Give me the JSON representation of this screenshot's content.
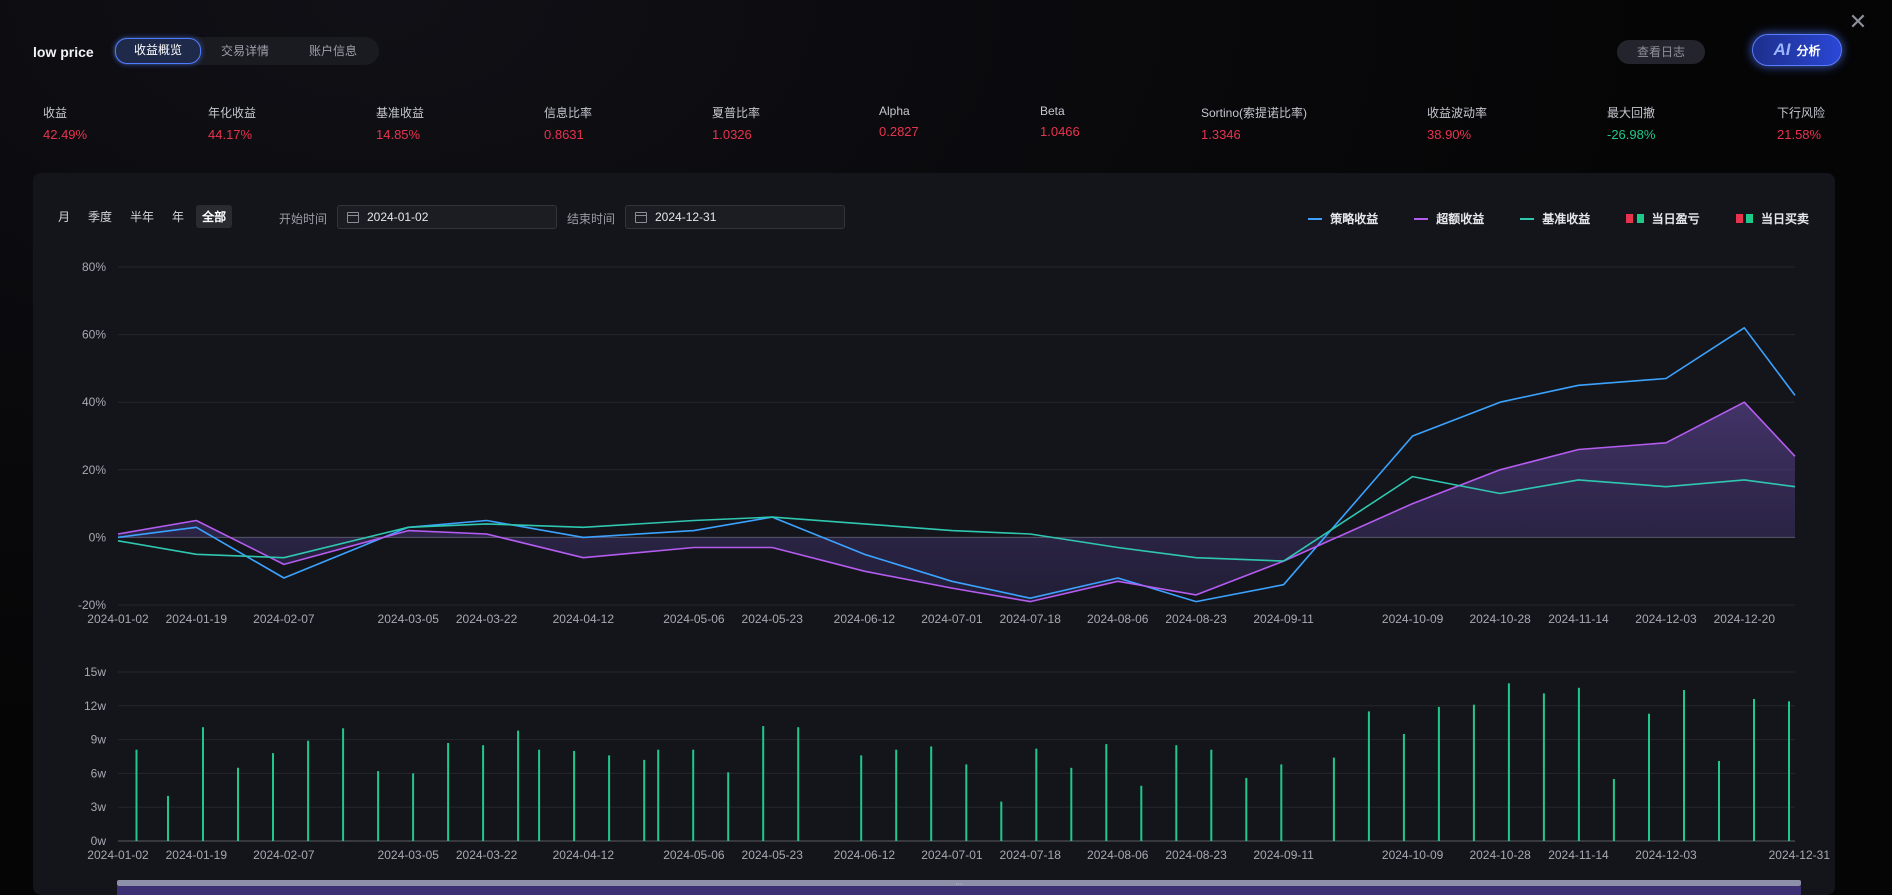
{
  "strategy_name": "low price",
  "tabs": [
    {
      "label": "收益概览",
      "active": true
    },
    {
      "label": "交易详情",
      "active": false
    },
    {
      "label": "账户信息",
      "active": false
    }
  ],
  "log_button": "查看日志",
  "ai_button": {
    "mark": "AI",
    "label": "分析"
  },
  "metrics": [
    {
      "label": "收益",
      "value": "42.49%",
      "tone": "red"
    },
    {
      "label": "年化收益",
      "value": "44.17%",
      "tone": "red"
    },
    {
      "label": "基准收益",
      "value": "14.85%",
      "tone": "red"
    },
    {
      "label": "信息比率",
      "value": "0.8631",
      "tone": "red"
    },
    {
      "label": "夏普比率",
      "value": "1.0326",
      "tone": "red"
    },
    {
      "label": "Alpha",
      "value": "0.2827",
      "tone": "red"
    },
    {
      "label": "Beta",
      "value": "1.0466",
      "tone": "red"
    },
    {
      "label": "Sortino(索提诺比率)",
      "value": "1.3346",
      "tone": "red"
    },
    {
      "label": "收益波动率",
      "value": "38.90%",
      "tone": "red"
    },
    {
      "label": "最大回撤",
      "value": "-26.98%",
      "tone": "green"
    },
    {
      "label": "下行风险",
      "value": "21.58%",
      "tone": "red"
    }
  ],
  "periods": [
    {
      "label": "月",
      "active": false
    },
    {
      "label": "季度",
      "active": false
    },
    {
      "label": "半年",
      "active": false
    },
    {
      "label": "年",
      "active": false
    },
    {
      "label": "全部",
      "active": true
    }
  ],
  "start_label": "开始时间",
  "start_date": "2024-01-02",
  "end_label": "结束时间",
  "end_date": "2024-12-31",
  "legend": [
    {
      "label": "策略收益",
      "kind": "line",
      "colors": [
        "#3ba3ff"
      ]
    },
    {
      "label": "超额收益",
      "kind": "line",
      "colors": [
        "#b45cf0"
      ]
    },
    {
      "label": "基准收益",
      "kind": "line",
      "colors": [
        "#2fc7b0"
      ]
    },
    {
      "label": "当日盈亏",
      "kind": "squares",
      "colors": [
        "#e8334f",
        "#1fc98a"
      ]
    },
    {
      "label": "当日买卖",
      "kind": "squares",
      "colors": [
        "#e8334f",
        "#1fc98a"
      ]
    }
  ],
  "colors": {
    "strategy": "#3ba3ff",
    "excess": "#b45cf0",
    "benchmark": "#2fc7b0",
    "up": "#e8334f",
    "down": "#1fc98a"
  },
  "chart_data": [
    {
      "type": "line",
      "title": "",
      "x_ticks": [
        "2024-01-02",
        "2024-01-19",
        "2024-02-07",
        "2024-03-05",
        "2024-03-22",
        "2024-04-12",
        "2024-05-06",
        "2024-05-23",
        "2024-06-12",
        "2024-07-01",
        "2024-07-18",
        "2024-08-06",
        "2024-08-23",
        "2024-09-11",
        "2024-10-09",
        "2024-10-28",
        "2024-11-14",
        "2024-12-03",
        "2024-12-20"
      ],
      "y_ticks": [
        "80%",
        "60%",
        "40%",
        "20%",
        "0%",
        "-20%"
      ],
      "ylim": [
        -20,
        80
      ],
      "grid": true,
      "series": [
        {
          "name": "策略收益",
          "color": "#3ba3ff",
          "x": [
            "2024-01-02",
            "2024-01-19",
            "2024-02-07",
            "2024-03-05",
            "2024-03-22",
            "2024-04-12",
            "2024-05-06",
            "2024-05-23",
            "2024-06-12",
            "2024-07-01",
            "2024-07-18",
            "2024-08-06",
            "2024-08-23",
            "2024-09-11",
            "2024-10-09",
            "2024-10-28",
            "2024-11-14",
            "2024-12-03",
            "2024-12-20",
            "2024-12-31"
          ],
          "values": [
            0,
            3,
            -12,
            3,
            5,
            0,
            2,
            6,
            -5,
            -13,
            -18,
            -12,
            -19,
            -14,
            30,
            40,
            45,
            47,
            62,
            42
          ]
        },
        {
          "name": "超额收益",
          "color": "#b45cf0",
          "x": [
            "2024-01-02",
            "2024-01-19",
            "2024-02-07",
            "2024-03-05",
            "2024-03-22",
            "2024-04-12",
            "2024-05-06",
            "2024-05-23",
            "2024-06-12",
            "2024-07-01",
            "2024-07-18",
            "2024-08-06",
            "2024-08-23",
            "2024-09-11",
            "2024-10-09",
            "2024-10-28",
            "2024-11-14",
            "2024-12-03",
            "2024-12-20",
            "2024-12-31"
          ],
          "values": [
            1,
            5,
            -8,
            2,
            1,
            -6,
            -3,
            -3,
            -10,
            -15,
            -19,
            -13,
            -17,
            -7,
            10,
            20,
            26,
            28,
            40,
            24
          ]
        },
        {
          "name": "基准收益",
          "color": "#2fc7b0",
          "x": [
            "2024-01-02",
            "2024-01-19",
            "2024-02-07",
            "2024-03-05",
            "2024-03-22",
            "2024-04-12",
            "2024-05-06",
            "2024-05-23",
            "2024-06-12",
            "2024-07-01",
            "2024-07-18",
            "2024-08-06",
            "2024-08-23",
            "2024-09-11",
            "2024-10-09",
            "2024-10-28",
            "2024-11-14",
            "2024-12-03",
            "2024-12-20",
            "2024-12-31"
          ],
          "values": [
            -1,
            -5,
            -6,
            3,
            4,
            3,
            5,
            6,
            4,
            2,
            1,
            -3,
            -6,
            -7,
            18,
            13,
            17,
            15,
            17,
            15
          ]
        }
      ]
    },
    {
      "type": "bar",
      "title": "",
      "x_ticks": [
        "2024-01-02",
        "2024-01-19",
        "2024-02-07",
        "2024-03-05",
        "2024-03-22",
        "2024-04-12",
        "2024-05-06",
        "2024-05-23",
        "2024-06-12",
        "2024-07-01",
        "2024-07-18",
        "2024-08-06",
        "2024-08-23",
        "2024-09-11",
        "2024-10-09",
        "2024-10-28",
        "2024-11-14",
        "2024-12-03",
        "2024-12-31"
      ],
      "y_ticks": [
        "15w",
        "12w",
        "9w",
        "6w",
        "3w",
        "0w"
      ],
      "ylim": [
        0,
        15
      ],
      "unit": "w",
      "bars": [
        {
          "day": 5,
          "value": 8.1,
          "color": "#1fc98a"
        },
        {
          "day": 14,
          "value": 4.0,
          "color": "#1fc98a"
        },
        {
          "day": 24,
          "value": 10.1,
          "color": "#1fc98a"
        },
        {
          "day": 34,
          "value": 6.5,
          "color": "#1fc98a"
        },
        {
          "day": 44,
          "value": 7.8,
          "color": "#1fc98a"
        },
        {
          "day": 54,
          "value": 8.9,
          "color": "#1fc98a"
        },
        {
          "day": 64,
          "value": 10.0,
          "color": "#1fc98a"
        },
        {
          "day": 74,
          "value": 6.2,
          "color": "#1fc98a"
        },
        {
          "day": 84,
          "value": 6.0,
          "color": "#1fc98a"
        },
        {
          "day": 94,
          "value": 8.7,
          "color": "#1fc98a"
        },
        {
          "day": 104,
          "value": 8.5,
          "color": "#1fc98a"
        },
        {
          "day": 114,
          "value": 9.8,
          "color": "#1fc98a"
        },
        {
          "day": 120,
          "value": 8.1,
          "color": "#1fc98a"
        },
        {
          "day": 130,
          "value": 8.0,
          "color": "#1fc98a"
        },
        {
          "day": 140,
          "value": 7.6,
          "color": "#1fc98a"
        },
        {
          "day": 150,
          "value": 7.2,
          "color": "#1fc98a"
        },
        {
          "day": 154,
          "value": 8.1,
          "color": "#1fc98a"
        },
        {
          "day": 164,
          "value": 8.1,
          "color": "#1fc98a"
        },
        {
          "day": 174,
          "value": 6.1,
          "color": "#1fc98a"
        },
        {
          "day": 184,
          "value": 10.2,
          "color": "#1fc98a"
        },
        {
          "day": 194,
          "value": 10.1,
          "color": "#1fc98a"
        },
        {
          "day": 212,
          "value": 7.6,
          "color": "#1fc98a"
        },
        {
          "day": 222,
          "value": 8.1,
          "color": "#1fc98a"
        },
        {
          "day": 232,
          "value": 8.4,
          "color": "#1fc98a"
        },
        {
          "day": 242,
          "value": 6.8,
          "color": "#1fc98a"
        },
        {
          "day": 252,
          "value": 3.5,
          "color": "#1fc98a"
        },
        {
          "day": 262,
          "value": 8.2,
          "color": "#1fc98a"
        },
        {
          "day": 272,
          "value": 6.5,
          "color": "#1fc98a"
        },
        {
          "day": 282,
          "value": 8.6,
          "color": "#1fc98a"
        },
        {
          "day": 292,
          "value": 4.9,
          "color": "#1fc98a"
        },
        {
          "day": 302,
          "value": 8.5,
          "color": "#1fc98a"
        },
        {
          "day": 312,
          "value": 8.1,
          "color": "#1fc98a"
        },
        {
          "day": 322,
          "value": 5.6,
          "color": "#1fc98a"
        },
        {
          "day": 332,
          "value": 6.8,
          "color": "#1fc98a"
        },
        {
          "day": 347,
          "value": 7.4,
          "color": "#1fc98a"
        },
        {
          "day": 357,
          "value": 11.5,
          "color": "#1fc98a"
        },
        {
          "day": 367,
          "value": 9.5,
          "color": "#1fc98a"
        },
        {
          "day": 377,
          "value": 11.9,
          "color": "#1fc98a"
        },
        {
          "day": 387,
          "value": 12.1,
          "color": "#1fc98a"
        },
        {
          "day": 397,
          "value": 14.0,
          "color": "#1fc98a"
        },
        {
          "day": 407,
          "value": 13.1,
          "color": "#1fc98a"
        },
        {
          "day": 417,
          "value": 13.6,
          "color": "#1fc98a"
        },
        {
          "day": 427,
          "value": 5.5,
          "color": "#1fc98a"
        },
        {
          "day": 437,
          "value": 11.3,
          "color": "#1fc98a"
        },
        {
          "day": 447,
          "value": 13.4,
          "color": "#1fc98a"
        },
        {
          "day": 457,
          "value": 7.1,
          "color": "#1fc98a"
        },
        {
          "day": 467,
          "value": 12.6,
          "color": "#1fc98a"
        },
        {
          "day": 477,
          "value": 12.4,
          "color": "#1fc98a"
        }
      ],
      "day_range": [
        0,
        479
      ]
    }
  ]
}
